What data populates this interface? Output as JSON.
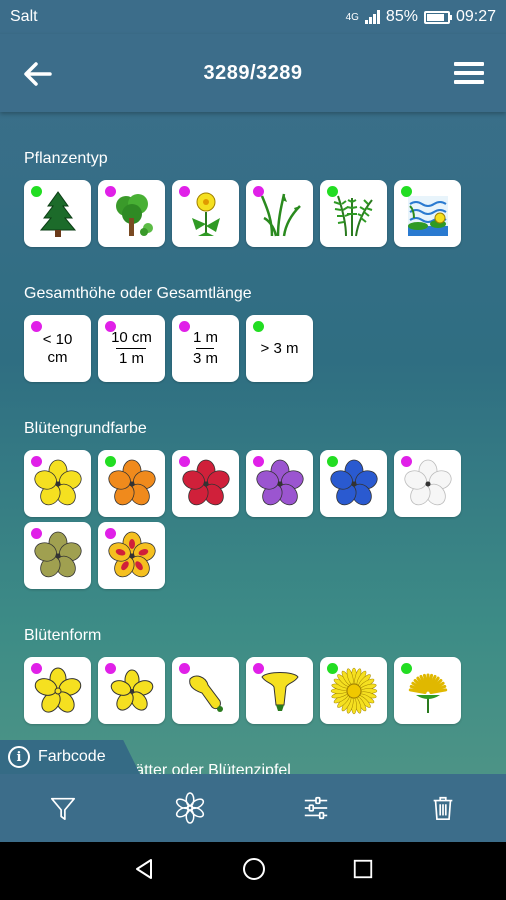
{
  "status_bar": {
    "carrier": "Salt",
    "network": "4G",
    "battery_percent": "85%",
    "battery_level": 0.85,
    "time": "09:27"
  },
  "app_bar": {
    "title": "3289/3289",
    "back_icon": "arrow-left-icon",
    "menu_icon": "hamburger-menu-icon"
  },
  "sections": [
    {
      "title": "Pflanzentyp",
      "tiles": [
        {
          "icon": "conifer-tree-icon",
          "dot": "green"
        },
        {
          "icon": "deciduous-tree-icon",
          "dot": "magenta"
        },
        {
          "icon": "herb-flower-icon",
          "dot": "magenta"
        },
        {
          "icon": "grass-icon",
          "dot": "magenta"
        },
        {
          "icon": "fern-icon",
          "dot": "green"
        },
        {
          "icon": "water-plant-icon",
          "dot": "green"
        }
      ]
    },
    {
      "title": "Gesamthöhe oder Gesamtlänge",
      "tiles": [
        {
          "line1": "< 10",
          "line2": "cm",
          "dot": "magenta"
        },
        {
          "top": "10 cm",
          "bottom": "1 m",
          "dot": "magenta"
        },
        {
          "top": "1 m",
          "bottom": "3 m",
          "dot": "magenta"
        },
        {
          "line1": "> 3 m",
          "dot": "green"
        }
      ]
    },
    {
      "title": "Blütengrundfarbe",
      "tiles": [
        {
          "icon": "yellow-flower-icon",
          "dot": "magenta",
          "color": "#f5e020"
        },
        {
          "icon": "orange-flower-icon",
          "dot": "green",
          "color": "#f08a1c"
        },
        {
          "icon": "red-flower-icon",
          "dot": "magenta",
          "color": "#d0203a"
        },
        {
          "icon": "purple-flower-icon",
          "dot": "magenta",
          "color": "#9b55d0"
        },
        {
          "icon": "blue-flower-icon",
          "dot": "green",
          "color": "#2a5ad0"
        },
        {
          "icon": "white-flower-icon",
          "dot": "magenta",
          "color": "#f6f6f6"
        },
        {
          "icon": "green-flower-icon",
          "dot": "magenta",
          "color": "#a0a050"
        },
        {
          "icon": "multicolor-flower-icon",
          "dot": "magenta",
          "color": "#f5c020"
        }
      ]
    },
    {
      "title": "Blütenform",
      "tiles": [
        {
          "icon": "five-petal-flower-icon",
          "dot": "magenta"
        },
        {
          "icon": "small-star-flower-icon",
          "dot": "magenta"
        },
        {
          "icon": "tubular-flower-icon",
          "dot": "magenta"
        },
        {
          "icon": "trumpet-flower-icon",
          "dot": "magenta"
        },
        {
          "icon": "daisy-flower-icon",
          "dot": "green"
        },
        {
          "icon": "dandelion-flower-icon",
          "dot": "green"
        }
      ]
    },
    {
      "title": "Anzahl Blütenblätter oder Blütenzipfel"
    }
  ],
  "info_tab": {
    "label": "Farbcode"
  },
  "bottom_toolbar": [
    "filter-icon",
    "flower-icon",
    "sliders-icon",
    "trash-icon"
  ],
  "nav_bar": [
    "back-triangle-icon",
    "home-circle-icon",
    "recents-square-icon"
  ]
}
